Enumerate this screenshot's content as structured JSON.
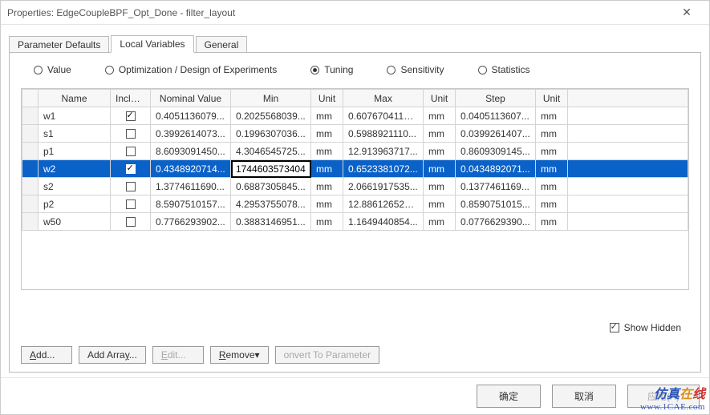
{
  "title": "Properties: EdgeCoupleBPF_Opt_Done - filter_layout",
  "close_glyph": "✕",
  "tabs": {
    "items": [
      "Parameter Defaults",
      "Local Variables",
      "General"
    ],
    "active_index": 1
  },
  "radios": {
    "items": [
      "Value",
      "Optimization / Design of Experiments",
      "Tuning",
      "Sensitivity",
      "Statistics"
    ],
    "selected_index": 2
  },
  "columns": [
    "",
    "Name",
    "Include",
    "Nominal Value",
    "Min",
    "Unit",
    "Max",
    "Unit",
    "Step",
    "Unit",
    ""
  ],
  "rows": [
    {
      "name": "w1",
      "include": true,
      "nominal": "0.4051136079...",
      "min": "0.2025568039...",
      "unit1": "mm",
      "max": "0.607670411921",
      "unit2": "mm",
      "step": "0.0405113607...",
      "unit3": "mm"
    },
    {
      "name": "s1",
      "include": false,
      "nominal": "0.3992614073...",
      "min": "0.1996307036...",
      "unit1": "mm",
      "max": "0.5988921110...",
      "unit2": "mm",
      "step": "0.0399261407...",
      "unit3": "mm"
    },
    {
      "name": "p1",
      "include": false,
      "nominal": "8.6093091450...",
      "min": "4.3046545725...",
      "unit1": "mm",
      "max": "12.913963717...",
      "unit2": "mm",
      "step": "0.8609309145...",
      "unit3": "mm"
    },
    {
      "name": "w2",
      "include": true,
      "nominal": "0.4348920714...",
      "min": "1744603573404",
      "unit1": "mm",
      "max": "0.6523381072...",
      "unit2": "mm",
      "step": "0.0434892071...",
      "unit3": "mm",
      "selected": true,
      "editing": "min"
    },
    {
      "name": "s2",
      "include": false,
      "nominal": "1.3774611690...",
      "min": "0.6887305845...",
      "unit1": "mm",
      "max": "2.0661917535...",
      "unit2": "mm",
      "step": "0.1377461169...",
      "unit3": "mm"
    },
    {
      "name": "p2",
      "include": false,
      "nominal": "8.5907510157...",
      "min": "4.2953755078...",
      "unit1": "mm",
      "max": "12.88612652367",
      "unit2": "mm",
      "step": "0.8590751015...",
      "unit3": "mm"
    },
    {
      "name": "w50",
      "include": false,
      "nominal": "0.7766293902...",
      "min": "0.3883146951...",
      "unit1": "mm",
      "max": "1.1649440854...",
      "unit2": "mm",
      "step": "0.0776629390...",
      "unit3": "mm"
    }
  ],
  "show_hidden": {
    "label": "Show Hidden",
    "checked": true
  },
  "buttons": {
    "add": "Add...",
    "add_array": "Add Array...",
    "edit": "Edit...",
    "remove": "Remove",
    "convert": "onvert To Parameter"
  },
  "footer": {
    "ok": "确定",
    "cancel": "取消",
    "apply": "应用(A)"
  },
  "watermark": {
    "line1_a": "仿真",
    "line1_b": "在",
    "line1_c": "线",
    "line2": "www.1CAE.com"
  }
}
